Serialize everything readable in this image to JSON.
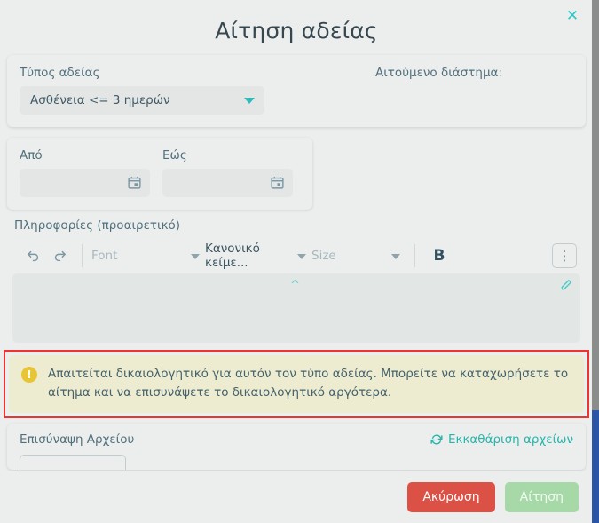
{
  "dialog": {
    "title": "Αίτηση αδείας",
    "close_icon": "close-icon",
    "close_label": "✕"
  },
  "leave_type": {
    "label": "Τύπος αδείας",
    "selected": "Ασθένεια <= 3 ημερών",
    "dropdown_icon": "chevron-down-icon"
  },
  "requested_period": {
    "label": "Αιτούμενο διάστημα:",
    "value": ""
  },
  "dates": {
    "from": {
      "label": "Από",
      "value": "",
      "icon": "calendar-icon"
    },
    "to": {
      "label": "Εώς",
      "value": "",
      "icon": "calendar-icon"
    }
  },
  "info": {
    "label": "Πληροφορίες (προαιρετικό)",
    "content": ""
  },
  "editor_toolbar": {
    "undo_icon": "undo-icon",
    "redo_icon": "redo-icon",
    "font_placeholder": "Font",
    "text_style": "Κανονικό κείμε...",
    "size_placeholder": "Size",
    "bold_label": "B",
    "more_label": "⋮",
    "collapse_icon": "chevron-up-icon",
    "pencil_icon": "pencil-icon"
  },
  "warning": {
    "icon": "exclamation-icon",
    "icon_label": "!",
    "text": "Απαιτείται δικαιολογητικό για αυτόν τον τύπο αδείας. Μπορείτε να καταχωρήσετε το αίτημα και να επισυνάψετε το δικαιολογητικό αργότερα.",
    "border_color": "#f1332f",
    "background_color": "#edecd0"
  },
  "attachment": {
    "title": "Επισύναψη Αρχείου",
    "clear_label": "Εκκαθάριση αρχείων",
    "clear_icon": "refresh-icon",
    "upload_label": ""
  },
  "footer": {
    "cancel_label": "Ακύρωση",
    "submit_label": "Αίτηση",
    "cancel_color": "#dc5145",
    "submit_color": "#a6d8a8"
  },
  "theme": {
    "accent": "#2dbdb6",
    "text": "#4a6572",
    "background": "#eceeed"
  }
}
